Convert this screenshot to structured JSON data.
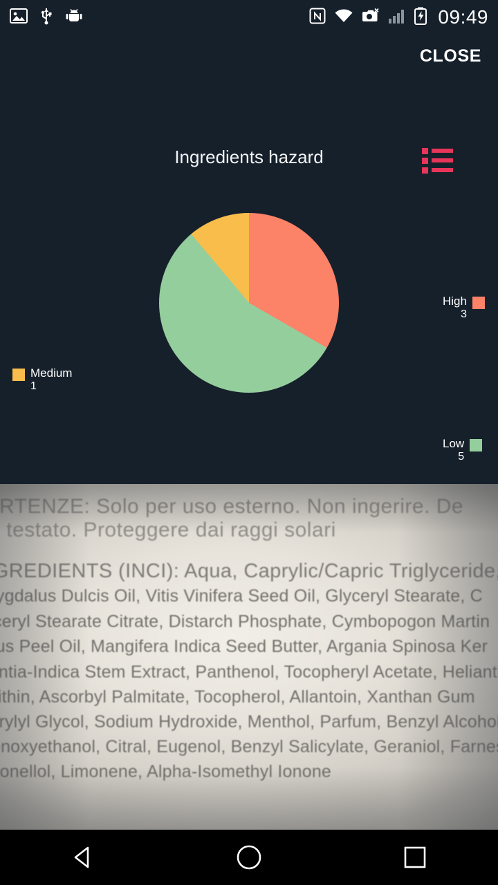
{
  "statusbar": {
    "icons": [
      "image-icon",
      "usb-icon",
      "android-debug-icon",
      "nfc-icon",
      "wifi-icon",
      "screenshot-error-icon",
      "signal-icon",
      "battery-charging-icon"
    ],
    "clock": "09:49"
  },
  "topbar": {
    "close_label": "CLOSE"
  },
  "chart_panel": {
    "title": "Ingredients hazard",
    "legend_toggle_icon": "list-icon",
    "background_color": "#16202b"
  },
  "chart_data": {
    "type": "pie",
    "title": "Ingredients hazard",
    "categories": [
      "High",
      "Low",
      "Medium"
    ],
    "values": [
      3,
      5,
      1
    ],
    "colors": [
      "#fc8268",
      "#95ce9d",
      "#f8bd4b"
    ],
    "legend_position": "around",
    "legend": [
      {
        "label": "High",
        "value": "3",
        "color": "#fc8268"
      },
      {
        "label": "Low",
        "value": "5",
        "color": "#95ce9d"
      },
      {
        "label": "Medium",
        "value": "1",
        "color": "#f8bd4b"
      }
    ]
  },
  "photo": {
    "lines": [
      "VERTENZE: Solo per uso esterno. Non ingerire. De",
      "no testato. Proteggere dai raggi solari",
      "INGREDIENTS (INCI): Aqua, Caprylic/Capric Triglyceride, Glycer",
      "Amygdalus Dulcis Oil, Vitis Vinifera Seed Oil, Glyceryl Stearate, C",
      "Glyceryl Stearate Citrate, Distarch Phosphate, Cymbopogon Martin",
      "Citrus Peel Oil, Mangifera Indica Seed Butter, Argania Spinosa Ker",
      "Opuntia-Indica Stem Extract, Panthenol, Tocopheryl Acetate, Helianthu",
      "Lecithin, Ascorbyl Palmitate, Tocopherol, Allantoin, Xanthan Gum",
      "Caprylyl Glycol, Sodium Hydroxide, Menthol, Parfum, Benzyl Alcohol",
      "Phenoxyethanol, Citral, Eugenol, Benzyl Salicylate, Geraniol, Farneso",
      "Citronellol, Limonene, Alpha-Isomethyl Ionone"
    ]
  },
  "navbar": {
    "back_icon": "triangle-back-icon",
    "home_icon": "circle-home-icon",
    "recents_icon": "square-recents-icon"
  }
}
